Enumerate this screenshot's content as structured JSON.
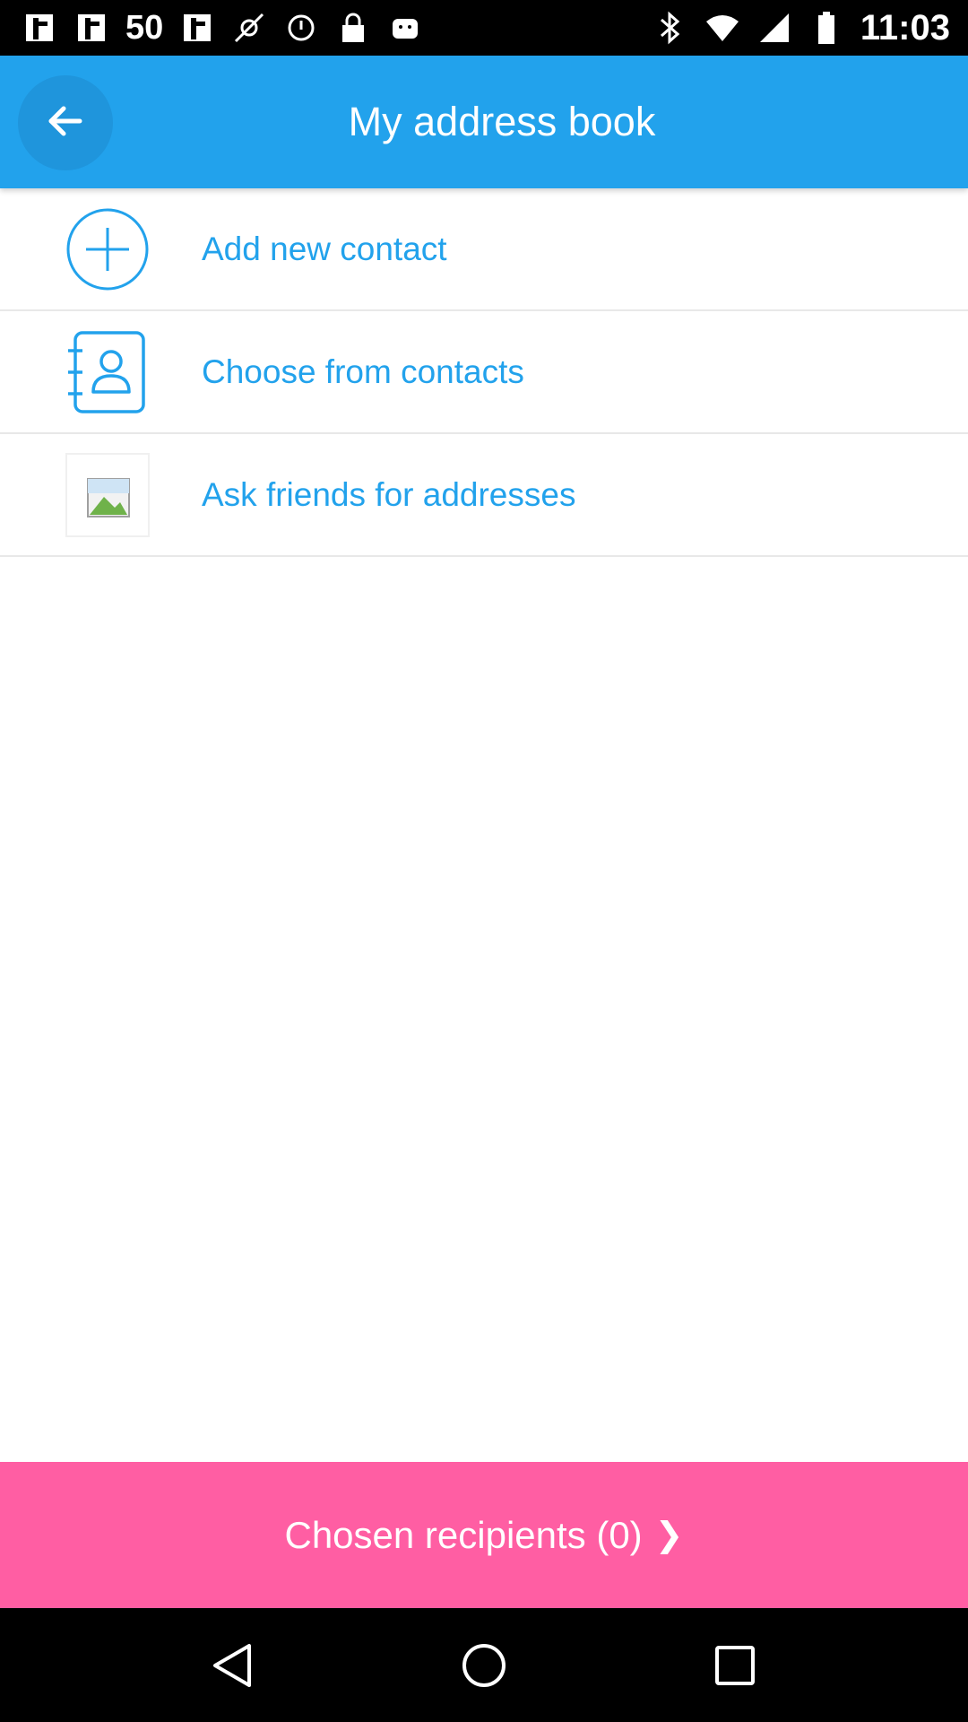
{
  "status_bar": {
    "signal_count": "50",
    "time": "11:03",
    "left_icons": [
      "app-icon",
      "app-icon",
      "app-icon",
      "fake-gps-icon",
      "alarm-icon",
      "lock-icon",
      "android-icon"
    ],
    "right_icons": [
      "bluetooth-icon",
      "wifi-icon",
      "cell-signal-icon",
      "battery-icon"
    ]
  },
  "app_bar": {
    "title": "My address book",
    "back_icon": "arrow-left-icon",
    "color": "#22a2ec"
  },
  "menu": {
    "items": [
      {
        "label": "Add new contact",
        "icon": "plus-circle-icon"
      },
      {
        "label": "Choose from contacts",
        "icon": "contacts-book-icon"
      },
      {
        "label": "Ask friends for addresses",
        "icon": "broken-image-icon"
      }
    ],
    "accent_color": "#22a2ec"
  },
  "bottom_button": {
    "label": "Chosen recipients (0)",
    "chevron": "❯",
    "color": "#ff5ea3"
  },
  "nav_bar": {
    "icons": [
      "back-triangle-icon",
      "home-circle-icon",
      "recents-square-icon"
    ]
  }
}
